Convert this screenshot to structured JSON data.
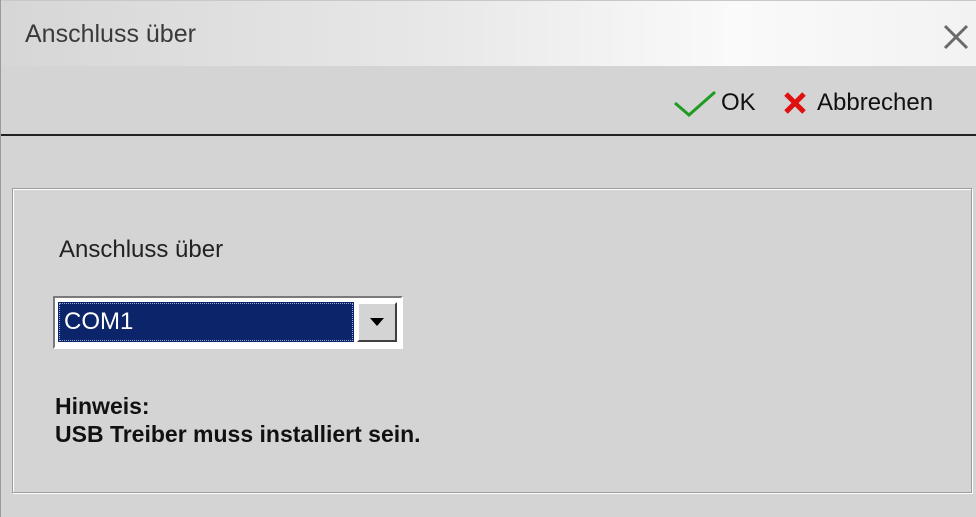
{
  "window": {
    "title": "Anschluss über"
  },
  "toolbar": {
    "ok_label": "OK",
    "cancel_label": "Abbrechen"
  },
  "panel": {
    "label": "Anschluss über",
    "port_select": {
      "selected": "COM1"
    },
    "hint_title": "Hinweis:",
    "hint_text": "USB Treiber muss installiert sein."
  },
  "icons": {
    "ok": "checkmark-icon",
    "cancel": "x-icon",
    "close": "close-icon",
    "dropdown": "chevron-down-icon"
  },
  "colors": {
    "ok_check": "#1f9b1f",
    "cancel_x": "#e01010",
    "selection_bg": "#0b246a"
  }
}
